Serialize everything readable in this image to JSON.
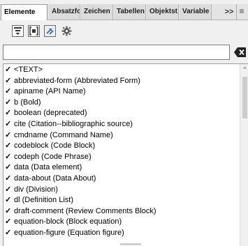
{
  "tabs": [
    {
      "label": "Elemente",
      "active": true
    },
    {
      "label": "Absatzfo",
      "active": false
    },
    {
      "label": "Zeichen",
      "active": false
    },
    {
      "label": "Tabellen",
      "active": false
    },
    {
      "label": "Objektst",
      "active": false
    },
    {
      "label": "Variable",
      "active": false
    }
  ],
  "tab_more_label": ">>",
  "tab_menu_glyph": "≡",
  "toolbar": [
    {
      "icon": "collapse-icon"
    },
    {
      "icon": "bracket-select-icon"
    },
    {
      "icon": "swap-arrows-icon"
    },
    {
      "icon": "gear-icon"
    }
  ],
  "search": {
    "value": "",
    "placeholder": ""
  },
  "check_mark": "✓",
  "elements": [
    {
      "name": "<TEXT>",
      "desc": ""
    },
    {
      "name": "abbreviated-form",
      "desc": "(Abbreviated Form)"
    },
    {
      "name": "apiname",
      "desc": "(API Name)"
    },
    {
      "name": "b",
      "desc": "(Bold)"
    },
    {
      "name": "boolean",
      "desc": "(deprecated)"
    },
    {
      "name": "cite",
      "desc": "(Citation--bibliographic source)"
    },
    {
      "name": "cmdname",
      "desc": "(Command Name)"
    },
    {
      "name": "codeblock",
      "desc": "(Code Block)"
    },
    {
      "name": "codeph",
      "desc": "(Code Phrase)"
    },
    {
      "name": "data",
      "desc": "(Data element)"
    },
    {
      "name": "data-about",
      "desc": "(Data About)"
    },
    {
      "name": "div",
      "desc": "(Division)"
    },
    {
      "name": "dl",
      "desc": "(Definition List)"
    },
    {
      "name": "draft-comment",
      "desc": "(Review Comments Block)"
    },
    {
      "name": "equation-block",
      "desc": "(Block equation)"
    },
    {
      "name": "equation-figure",
      "desc": "(Equation figure)"
    }
  ]
}
